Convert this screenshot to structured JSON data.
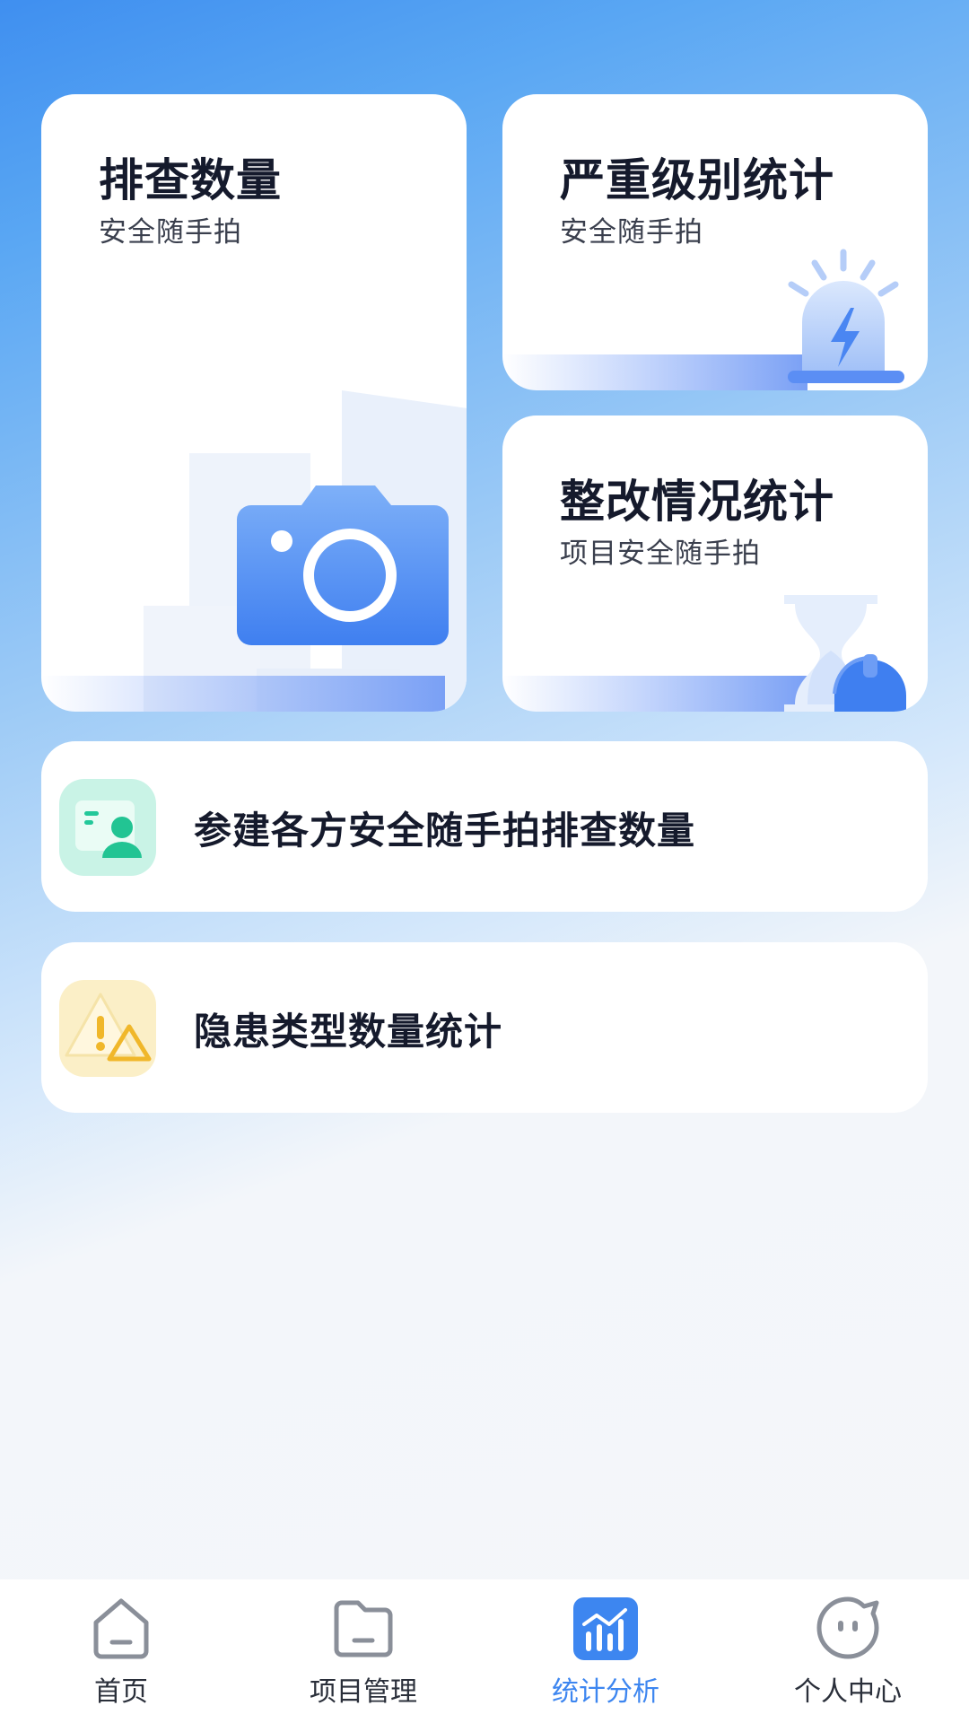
{
  "cards": {
    "inspection_count": {
      "title": "排查数量",
      "subtitle": "安全随手拍"
    },
    "severity_stats": {
      "title": "严重级别统计",
      "subtitle": "安全随手拍"
    },
    "rectification_stats": {
      "title": "整改情况统计",
      "subtitle": "项目安全随手拍"
    }
  },
  "rows": {
    "parties_inspection": {
      "label": "参建各方安全随手拍排查数量",
      "icon": "person-card-icon"
    },
    "hazard_types": {
      "label": "隐患类型数量统计",
      "icon": "warning-icon"
    }
  },
  "tabbar": {
    "items": [
      {
        "label": "首页",
        "icon": "home-icon"
      },
      {
        "label": "项目管理",
        "icon": "folder-icon"
      },
      {
        "label": "统计分析",
        "icon": "stats-icon",
        "active": true
      },
      {
        "label": "个人中心",
        "icon": "profile-icon"
      }
    ],
    "active_color": "#3d86f0"
  }
}
